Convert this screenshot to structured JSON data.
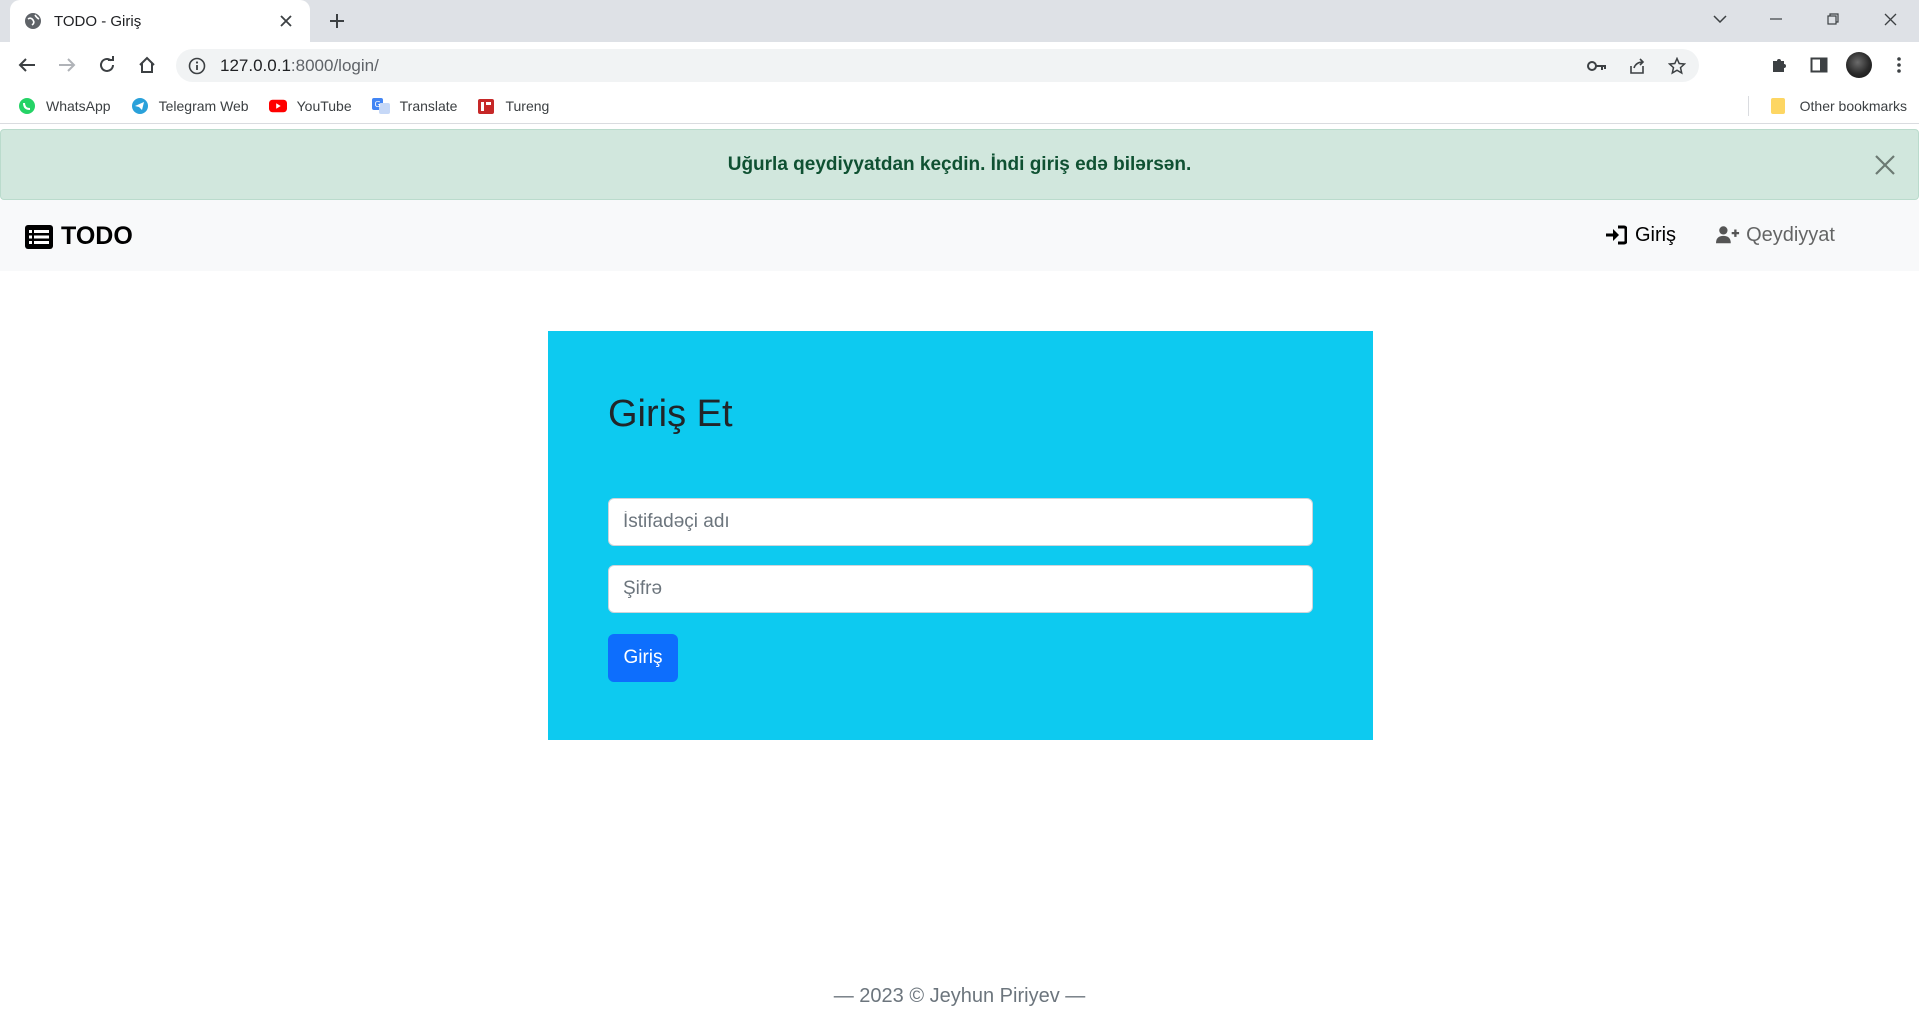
{
  "browser": {
    "tab_title": "TODO - Giriş",
    "url_host": "127.0.0.1",
    "url_path": ":8000/login/",
    "bookmarks": [
      {
        "label": "WhatsApp",
        "icon": "whatsapp-icon",
        "color": "#25d366"
      },
      {
        "label": "Telegram Web",
        "icon": "telegram-icon",
        "color": "#2aa1da"
      },
      {
        "label": "YouTube",
        "icon": "youtube-icon",
        "color": "#ff0000"
      },
      {
        "label": "Translate",
        "icon": "translate-icon",
        "color": "#4285f4"
      },
      {
        "label": "Tureng",
        "icon": "tureng-icon",
        "color": "#c62828"
      }
    ],
    "other_bookmarks": "Other bookmarks"
  },
  "alert": {
    "message": "Uğurla qeydiyyatdan keçdin. İndi giriş edə bilərsən.",
    "color": "#d1e7dd"
  },
  "navbar": {
    "brand": "TODO",
    "links": [
      {
        "label": "Giriş",
        "icon": "sign-in-icon"
      },
      {
        "label": "Qeydiyyat",
        "icon": "user-plus-icon"
      }
    ]
  },
  "login": {
    "title": "Giriş Et",
    "username_placeholder": "İstifadəçi adı",
    "password_placeholder": "Şifrə",
    "submit_label": "Giriş",
    "card_color": "#0dcaf0",
    "button_color": "#0d6efd"
  },
  "footer": {
    "text": "— 2023 © Jeyhun Piriyev —"
  }
}
